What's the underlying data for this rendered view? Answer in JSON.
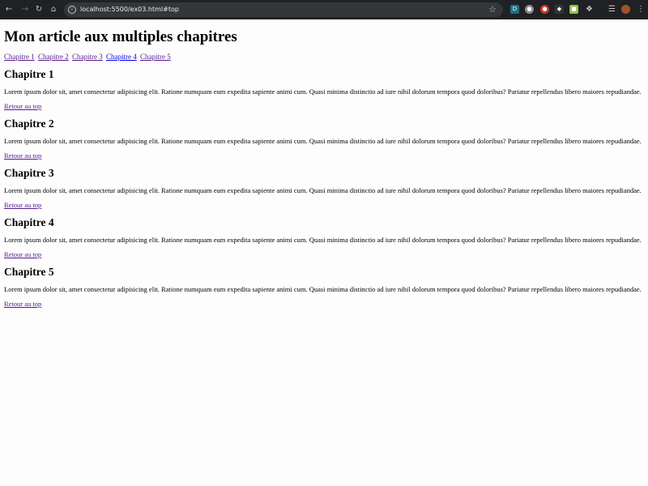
{
  "browser": {
    "url": "localhost:5500/ex03.html#top",
    "back_icon": "arrow-left-icon",
    "forward_icon": "arrow-right-icon",
    "reload_icon": "reload-icon",
    "home_icon": "home-icon",
    "star_icon": "star-icon",
    "menu_icon": "kebab-menu-icon"
  },
  "page": {
    "title": "Mon article aux multiples chapitres",
    "toc": [
      {
        "label": "Chapitre 1",
        "visited": true
      },
      {
        "label": "Chapitre 2",
        "visited": true
      },
      {
        "label": "Chapitre 3",
        "visited": true
      },
      {
        "label": "Chapitre 4",
        "visited": false
      },
      {
        "label": "Chapitre 5",
        "visited": true
      }
    ],
    "chapters": [
      {
        "heading": "Chapitre 1",
        "text": "Lorem ipsum dolor sit, amet consectetur adipisicing elit. Ratione numquam eum expedita sapiente animi cum. Quasi minima distinctio ad iure nihil dolorum tempora quod doloribus? Pariatur repellendus libero maiores repudiandae.",
        "back_label": "Retour au top"
      },
      {
        "heading": "Chapitre 2",
        "text": "Lorem ipsum dolor sit, amet consectetur adipisicing elit. Ratione numquam eum expedita sapiente animi cum. Quasi minima distinctio ad iure nihil dolorum tempora quod doloribus? Pariatur repellendus libero maiores repudiandae.",
        "back_label": "Retour au top"
      },
      {
        "heading": "Chapitre 3",
        "text": "Lorem ipsum dolor sit, amet consectetur adipisicing elit. Ratione numquam eum expedita sapiente animi cum. Quasi minima distinctio ad iure nihil dolorum tempora quod doloribus? Pariatur repellendus libero maiores repudiandae.",
        "back_label": "Retour au top"
      },
      {
        "heading": "Chapitre 4",
        "text": "Lorem ipsum dolor sit, amet consectetur adipisicing elit. Ratione numquam eum expedita sapiente animi cum. Quasi minima distinctio ad iure nihil dolorum tempora quod doloribus? Pariatur repellendus libero maiores repudiandae.",
        "back_label": "Retour au top"
      },
      {
        "heading": "Chapitre 5",
        "text": "Lorem ipsum dolor sit, amet consectetur adipisicing elit. Ratione numquam eum expedita sapiente animi cum. Quasi minima distinctio ad iure nihil dolorum tempora quod doloribus? Pariatur repellendus libero maiores repudiandae.",
        "back_label": "Retour au top"
      }
    ]
  },
  "colors": {
    "visited_link": "#551a8b",
    "unvisited_link": "#0000ee",
    "browser_bar": "#202124"
  }
}
